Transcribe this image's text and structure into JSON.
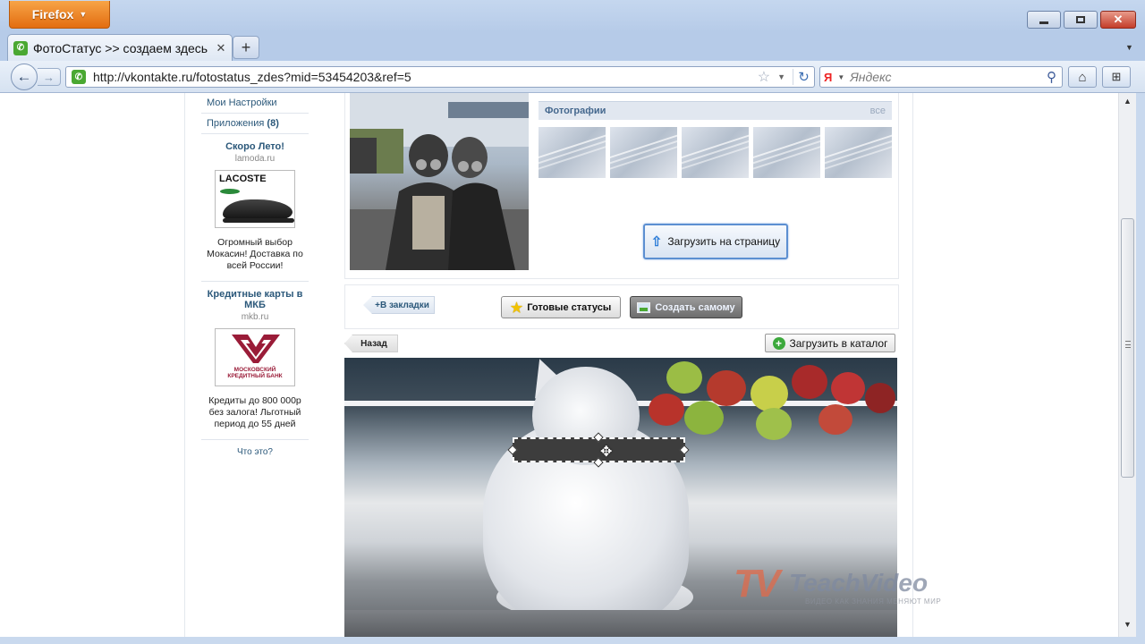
{
  "browser": {
    "app_button": "Firefox",
    "tab_title": "ФотоСтатус >> создаем здесь ...",
    "url": "http://vkontakte.ru/fotostatus_zdes?mid=53454203&ref=5",
    "search_placeholder": "Яндекс",
    "search_engine_letter": "Я"
  },
  "sidebar": {
    "settings_link": "Мои Настройки",
    "apps_link": "Приложения",
    "apps_count": "(8)",
    "ads": [
      {
        "title": "Скоро Лето!",
        "domain": "lamoda.ru",
        "image_text": "LACOSTE",
        "text": "Огромный выбор Мокасин! Доставка по всей России!"
      },
      {
        "title": "Кредитные карты в МКБ",
        "domain": "mkb.ru",
        "image_text": "МОСКОВСКИЙ КРЕДИТНЫЙ БАНК",
        "text": "Кредиты до 800 000р без залога! Льготный период до 55 дней"
      }
    ],
    "what_is_this": "Что это?"
  },
  "profile": {
    "photos_title": "Фотографии",
    "photos_all": "все",
    "upload_button": "Загрузить на страницу"
  },
  "actions": {
    "bookmark": "+В закладки",
    "ready_statuses": "Готовые статусы",
    "create_own": "Создать самому"
  },
  "editor": {
    "back": "Назад",
    "upload_catalog": "Загрузить в каталог"
  },
  "watermark": {
    "logo": "TV",
    "name": "TeachVideo",
    "tagline": "ВИДЕО КАК ЗНАНИЯ МЕНЯЮТ МИР"
  },
  "colors": {
    "vk_link": "#2b587a",
    "firefox_orange": "#e36d10",
    "vk_green": "#4aa832"
  }
}
